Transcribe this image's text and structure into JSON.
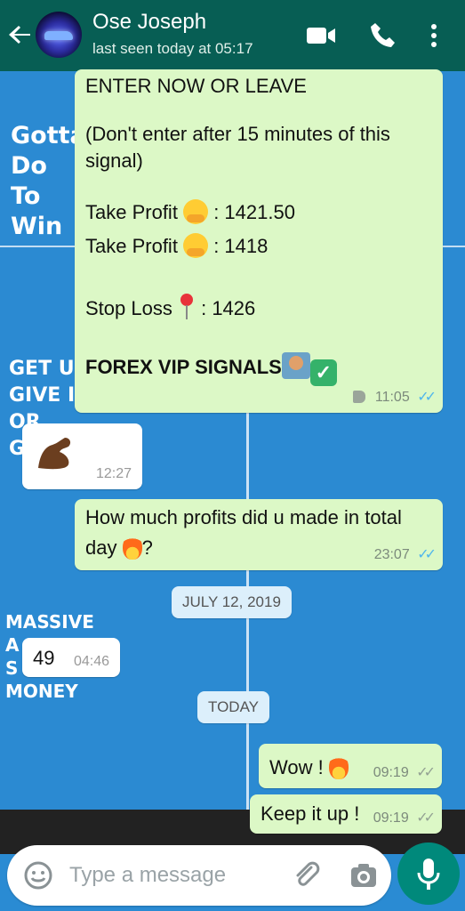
{
  "header": {
    "contact_name": "Ose Joseph",
    "status": "last seen today at 05:17",
    "back_icon": "arrow-left-icon",
    "icons": [
      "video-call-icon",
      "phone-icon",
      "more-vert-icon"
    ]
  },
  "wallpaper": {
    "poster1": [
      "Gotta",
      "Do",
      "To",
      "Win"
    ],
    "poster2": [
      "GET UP",
      "GIVE IT",
      "OR",
      "G"
    ],
    "poster3": [
      "MASSIVE",
      "A",
      "S",
      "MONEY"
    ]
  },
  "messages": {
    "signal": {
      "line1": "ENTER NOW OR LEAVE",
      "line2": "(Don't enter after 15 minutes of this signal)",
      "tp1_label": "Take Profit",
      "tp1_value": ": 1421.50",
      "tp2_label": "Take Profit",
      "tp2_value": ": 1418",
      "sl_label": "Stop Loss",
      "sl_value": ": 1426",
      "footer": "FOREX VIP SIGNALS",
      "time": "11:05"
    },
    "muscle": {
      "time": "12:27"
    },
    "question": {
      "text_a": "How much profits did u made in total",
      "text_b": "day",
      "text_c": "?",
      "time": "23:07"
    },
    "date1": "JULY 12, 2019",
    "reply49": {
      "text": "49",
      "time": "04:46"
    },
    "date2": "TODAY",
    "wow": {
      "text": "Wow !",
      "time": "09:19"
    },
    "keep": {
      "text": "Keep it up !",
      "time": "09:19"
    }
  },
  "input": {
    "placeholder": "Type a message",
    "icons": [
      "emoji-icon",
      "attach-icon",
      "camera-icon",
      "mic-icon"
    ]
  },
  "colors": {
    "header": "#075e54",
    "outgoing": "#dcf8c6",
    "incoming": "#ffffff",
    "read_ticks": "#4fb6ec",
    "mic": "#00897b"
  }
}
